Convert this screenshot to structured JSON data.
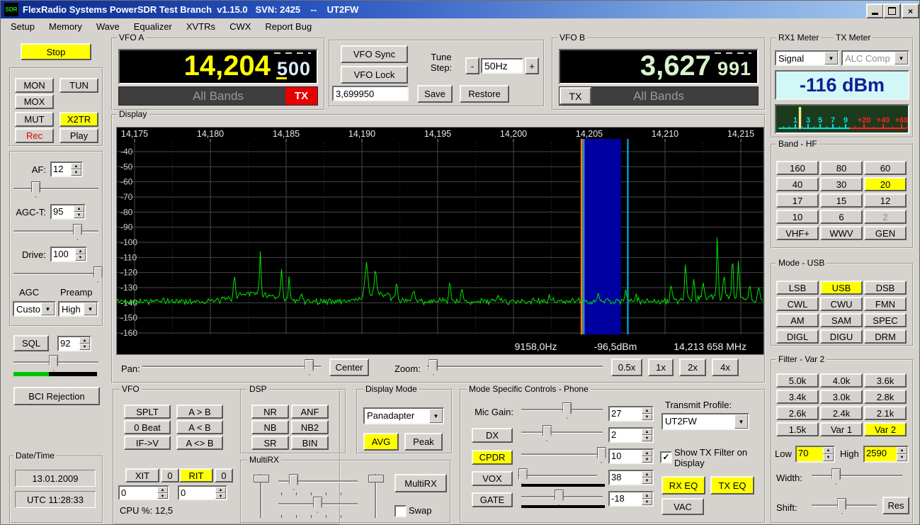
{
  "window": {
    "title": "FlexRadio Systems PowerSDR Test Branch  v1.15.0   SVN: 2425    --    UT2FW",
    "close": "×"
  },
  "menu": {
    "items": [
      "Setup",
      "Memory",
      "Wave",
      "Equalizer",
      "XVTRs",
      "CWX",
      "Report Bug"
    ]
  },
  "left": {
    "stop": "Stop",
    "transport": {
      "mon": "MON",
      "tun": "TUN",
      "mox": "MOX",
      "mut": "MUT",
      "x2tr": "X2TR",
      "rec": "Rec",
      "play": "Play"
    },
    "gains": {
      "af_label": "AF:",
      "af": "12",
      "agct_label": "AGC-T:",
      "agct": "95",
      "drive_label": "Drive:",
      "drive": "100",
      "agc_label": "AGC",
      "preamp_label": "Preamp",
      "agc_value": "Custo",
      "preamp_value": "High"
    },
    "sql": {
      "label": "SQL",
      "value": "92"
    },
    "bci": "BCI Rejection",
    "datetime": {
      "label": "Date/Time",
      "date": "13.01.2009",
      "time": "UTC 11:28:33"
    }
  },
  "vfoA": {
    "label": "VFO A",
    "freq_main": "14,204",
    "freq_sub": "500",
    "band": "All Bands",
    "tx": "TX"
  },
  "vfoB": {
    "label": "VFO B",
    "freq_main": "3,627",
    "freq_sub": "991",
    "band": "All Bands",
    "tx": "TX"
  },
  "sync_panel": {
    "sync": "VFO Sync",
    "lock": "VFO Lock",
    "tune_step_label": "Tune Step:",
    "minus": "-",
    "step": "50Hz",
    "plus": "+",
    "memory": "3,699950",
    "save": "Save",
    "restore": "Restore"
  },
  "meter": {
    "rx_label": "RX1 Meter",
    "tx_label": "TX Meter",
    "rx_mode": "Signal",
    "tx_mode": "ALC Comp",
    "reading": "-116 dBm",
    "scale_cyan": [
      "1",
      "3",
      "5",
      "7",
      "9"
    ],
    "scale_red": [
      "+20",
      "+40",
      "+60"
    ]
  },
  "band": {
    "label": "Band - HF",
    "active": "20",
    "disabled": [
      "2"
    ],
    "buttons": [
      "160",
      "80",
      "60",
      "40",
      "30",
      "20",
      "17",
      "15",
      "12",
      "10",
      "6",
      "2",
      "VHF+",
      "WWV",
      "GEN"
    ]
  },
  "mode": {
    "label": "Mode - USB",
    "active": "USB",
    "buttons": [
      "LSB",
      "USB",
      "DSB",
      "CWL",
      "CWU",
      "FMN",
      "AM",
      "SAM",
      "SPEC",
      "DIGL",
      "DIGU",
      "DRM"
    ]
  },
  "filter": {
    "label": "Filter - Var 2",
    "active": "Var 2",
    "buttons": [
      "5.0k",
      "4.0k",
      "3.6k",
      "3.4k",
      "3.0k",
      "2.8k",
      "2.6k",
      "2.4k",
      "2.1k",
      "1.5k",
      "Var 1",
      "Var 2"
    ],
    "low_label": "Low",
    "low": "70",
    "high_label": "High",
    "high": "2590",
    "width_label": "Width:",
    "shift_label": "Shift:",
    "res": "Res"
  },
  "display": {
    "label": "Display",
    "freq_ticks": [
      "14,175",
      "14,180",
      "14,185",
      "14,190",
      "14,195",
      "14,200",
      "14,205",
      "14,210",
      "14,215"
    ],
    "db_ticks": [
      "-40",
      "-50",
      "-60",
      "-70",
      "-80",
      "-90",
      "-100",
      "-110",
      "-120",
      "-130",
      "-140",
      "-150",
      "-160"
    ],
    "status": {
      "cursor_hz": "9158,0Hz",
      "cursor_dbm": "-96,5dBm",
      "cursor_freq": "14,213 658 MHz"
    },
    "pan_label": "Pan:",
    "center": "Center",
    "zoom_label": "Zoom:",
    "zoom_buttons": [
      "0.5x",
      "1x",
      "2x",
      "4x"
    ],
    "spectrum": {
      "x_min": 14175,
      "x_max": 14216.5,
      "noise_floor": -139,
      "filter": {
        "carrier": 14204.5,
        "rx_pass_low_khz": 0.07,
        "rx_pass_high_khz": 2.59,
        "tx_edge_khz": 3.0
      },
      "colors": {
        "trace": "#00e400",
        "grid": "#474747",
        "passband": "#0000a0",
        "carrier_line": "#ff7d00",
        "tx_line": "#00b4ff"
      },
      "peaks": [
        [
          14182.8,
          6,
          1.0
        ],
        [
          14190.9,
          5,
          0.8
        ],
        [
          14213.6,
          3,
          1.2
        ],
        [
          14181.6,
          13,
          0.06
        ],
        [
          14183.3,
          27,
          0.05
        ],
        [
          14184.7,
          19,
          0.06
        ],
        [
          14185.2,
          16,
          0.05
        ],
        [
          14186.0,
          8,
          0.05
        ],
        [
          14190.3,
          22,
          0.09
        ],
        [
          14190.9,
          16,
          0.07
        ],
        [
          14192.3,
          11,
          0.06
        ],
        [
          14193.4,
          7,
          0.08
        ],
        [
          14195.8,
          14,
          0.05
        ],
        [
          14196.6,
          7,
          0.06
        ],
        [
          14199.0,
          4,
          0.07
        ],
        [
          14202.4,
          4,
          0.06
        ],
        [
          14205.6,
          4,
          0.06
        ],
        [
          14207.4,
          6,
          0.06
        ],
        [
          14208.1,
          5,
          0.05
        ],
        [
          14210.4,
          12,
          0.06
        ],
        [
          14211.35,
          23,
          0.06
        ],
        [
          14211.9,
          14,
          0.06
        ],
        [
          14212.5,
          9,
          0.07
        ],
        [
          14213.45,
          41,
          0.05
        ],
        [
          14213.9,
          15,
          0.06
        ],
        [
          14214.45,
          28,
          0.05
        ],
        [
          14214.85,
          25,
          0.06
        ],
        [
          14215.6,
          10,
          0.07
        ],
        [
          14216.2,
          9,
          0.08
        ]
      ]
    }
  },
  "vfo_ops": {
    "label": "VFO",
    "buttons": [
      "SPLT",
      "A > B",
      "0 Beat",
      "A < B",
      "IF->V",
      "A <> B"
    ],
    "xit": "XIT",
    "xit_zero": "0",
    "rit": "RIT",
    "rit_zero": "0",
    "xit_value": "0",
    "rit_value": "0",
    "cpu": "CPU %: 12,5"
  },
  "dsp": {
    "label": "DSP",
    "buttons": [
      "NR",
      "ANF",
      "NB",
      "NB2",
      "SR",
      "BIN"
    ]
  },
  "multirx": {
    "label": "MultiRX",
    "button": "MultiRX",
    "swap": "Swap"
  },
  "display_mode": {
    "label": "Display Mode",
    "value": "Panadapter",
    "avg": "AVG",
    "peak": "Peak"
  },
  "mode_controls": {
    "label": "Mode Specific Controls - Phone",
    "mic_label": "Mic Gain:",
    "mic": "27",
    "dx": "DX",
    "dx_value": "2",
    "cpdr": "CPDR",
    "cpdr_value": "10",
    "vox": "VOX",
    "vox_value": "38",
    "gate": "GATE",
    "gate_value": "-18",
    "profile_label": "Transmit Profile:",
    "profile": "UT2FW",
    "show_tx": "Show TX Filter on Display",
    "rxeq": "RX EQ",
    "txeq": "TX EQ",
    "vac": "VAC"
  }
}
